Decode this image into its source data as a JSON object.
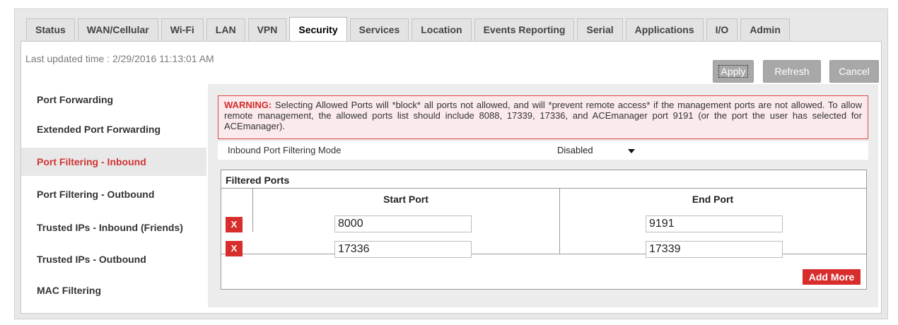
{
  "tabs": [
    {
      "label": "Status"
    },
    {
      "label": "WAN/Cellular"
    },
    {
      "label": "Wi-Fi"
    },
    {
      "label": "LAN"
    },
    {
      "label": "VPN"
    },
    {
      "label": "Security",
      "active": true
    },
    {
      "label": "Services"
    },
    {
      "label": "Location"
    },
    {
      "label": "Events Reporting"
    },
    {
      "label": "Serial"
    },
    {
      "label": "Applications"
    },
    {
      "label": "I/O"
    },
    {
      "label": "Admin"
    }
  ],
  "header": {
    "last_updated": "Last updated time : 2/29/2016 11:13:01 AM",
    "apply_label": "Apply",
    "refresh_label": "Refresh",
    "cancel_label": "Cancel"
  },
  "sidebar": {
    "items": [
      {
        "label": "Port Forwarding"
      },
      {
        "label": "Extended Port Forwarding"
      },
      {
        "label": "Port Filtering - Inbound",
        "active": true
      },
      {
        "label": "Port Filtering - Outbound"
      },
      {
        "label": "Trusted IPs - Inbound (Friends)"
      },
      {
        "label": "Trusted IPs - Outbound"
      },
      {
        "label": "MAC Filtering"
      }
    ]
  },
  "warning": {
    "prefix": "WARNING:",
    "text": " Selecting Allowed Ports will *block* all ports not allowed, and will *prevent remote access* if the management ports are not allowed. To allow remote management, the allowed ports list should include 8088, 17339, 17336, and ACEmanager port 9191 (or the port the user has selected for ACEmanager)."
  },
  "mode": {
    "label": "Inbound Port Filtering Mode",
    "value": "Disabled"
  },
  "ports": {
    "title": "Filtered Ports",
    "start_header": "Start Port",
    "end_header": "End Port",
    "delete_label": "X",
    "rows": [
      {
        "start": "8000",
        "end": "9191"
      },
      {
        "start": "17336",
        "end": "17339"
      }
    ],
    "add_more_label": "Add More"
  },
  "colors": {
    "accent_red": "#d82d2d",
    "active_text": "#d13434",
    "warning_bg": "#fbeaec",
    "button_gray": "#a8a8a8"
  }
}
